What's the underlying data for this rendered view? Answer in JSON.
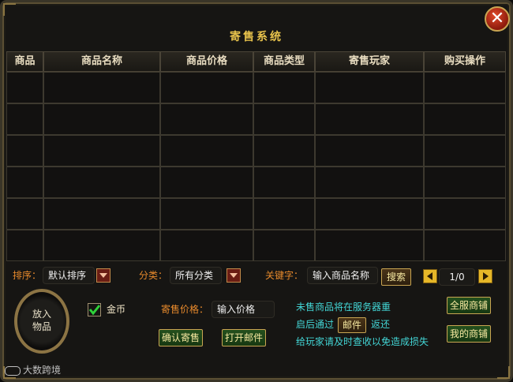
{
  "window": {
    "title": "寄售系统",
    "close_glyph": "✕"
  },
  "table": {
    "headers": [
      "商品",
      "商品名称",
      "商品价格",
      "商品类型",
      "寄售玩家",
      "购买操作"
    ],
    "row_count": 6
  },
  "filters": {
    "sort_label": "排序：",
    "sort_value": "默认排序",
    "category_label": "分类：",
    "category_value": "所有分类",
    "keyword_label": "关键字：",
    "keyword_value": "输入商品名称",
    "search_button": "搜索",
    "page_indicator": "1/0"
  },
  "consign": {
    "slot_line1": "放入",
    "slot_line2": "物品",
    "gold_label": "金币",
    "gold_checked": true,
    "price_label": "寄售价格：",
    "price_value": "输入价格",
    "confirm_button": "确认寄售",
    "mail_button": "打开邮件"
  },
  "notice": {
    "line1": "未售商品将在服务器重",
    "line2_pre": "启后通过",
    "line2_mail": "邮件",
    "line2_post": "返还",
    "line3": "给玩家请及时查收以免造成损失"
  },
  "side_buttons": {
    "all_shops": "全服商铺",
    "my_shop": "我的商铺"
  },
  "watermark": "大数跨境",
  "colors": {
    "accent_gold": "#e8c34c",
    "label_orange": "#e88a2c",
    "notice_cyan": "#43d6d6",
    "button_green": "#24501d"
  }
}
